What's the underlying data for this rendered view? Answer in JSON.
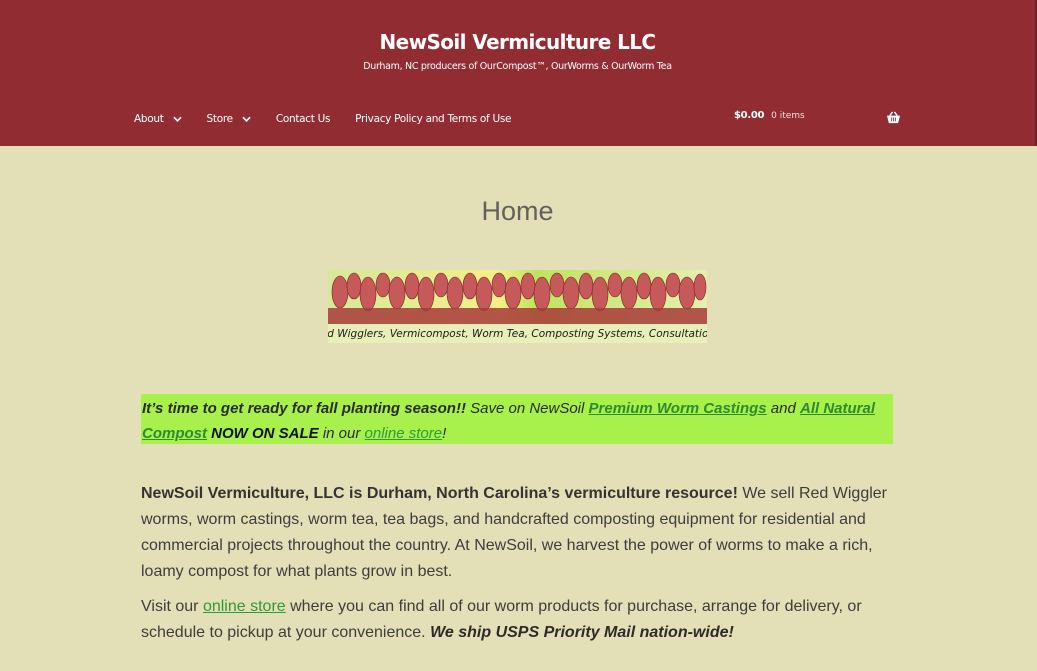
{
  "header": {
    "site_title": "NewSoil Vermiculture LLC",
    "tagline": "Durham, NC producers of OurCompost™, OurWorms & OurWorm Tea",
    "bg_color": "#912d32"
  },
  "nav": {
    "about": "About",
    "store": "Store",
    "contact": "Contact Us",
    "privacy": "Privacy Policy and Terms of Use"
  },
  "cart": {
    "total": "$0.00",
    "count": "0 items",
    "icon": "basket-icon"
  },
  "page": {
    "title": "Home",
    "banner_caption": "Red Wigglers, Vermicompost, Worm Tea, Composting Systems, Consultations"
  },
  "promo": {
    "lead": "It’s time to get ready for fall planting season!!",
    "save_text": " Save on NewSoil ",
    "link1": "Premium Worm Castings",
    "and_text": " and ",
    "link2": "All Natural Compost",
    "sale_text": " NOW ON SALE",
    "in_our": " in our ",
    "store_link": "online store",
    "end": "!",
    "bg_color": "#a8f04b"
  },
  "intro": {
    "bold": "NewSoil Vermiculture, LLC is Durham, North Carolina’s vermiculture resource!",
    "body": "  We sell Red Wiggler worms, worm castings, worm tea, tea bags, and handcrafted composting equipment for residential and commercial projects throughout the country.  At NewSoil, we harvest the power of worms to make a rich, loamy compost for what plants grow in best."
  },
  "visit": {
    "pre": "Visit our ",
    "link": " online store",
    "mid": " where you can find all of our worm products for purchase, arrange for delivery, or schedule to pickup at your convenience. ",
    "bold_end": "We ship USPS Priority Mail nation-wide!"
  }
}
